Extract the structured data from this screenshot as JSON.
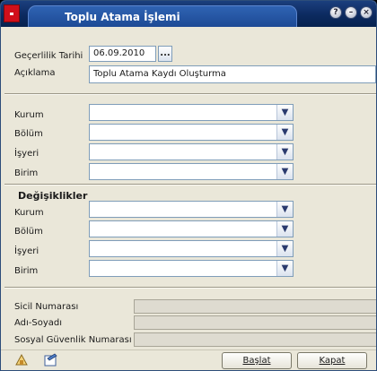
{
  "window": {
    "title": "Toplu Atama İşlemi",
    "controls": {
      "help": "?",
      "minimize": "–",
      "close": "×"
    }
  },
  "top": {
    "date_label": "Geçerlilik Tarihi",
    "date_value": "06.09.2010",
    "date_button": "...",
    "desc_label": "Açıklama",
    "desc_value": "Toplu Atama Kaydı Oluşturma"
  },
  "criteria": {
    "kurum": "Kurum",
    "bolum": "Bölüm",
    "isyeri": "İşyeri",
    "birim": "Birim"
  },
  "changes": {
    "heading": "Değişiklikler",
    "kurum": "Kurum",
    "bolum": "Bölüm",
    "isyeri": "İşyeri",
    "birim": "Birim"
  },
  "info": {
    "sicil": "Sicil Numarası",
    "adsoyad": "Adı-Soyadı",
    "sgk": "Sosyal Güvenlik Numarası"
  },
  "buttons": {
    "start": "Başlat",
    "close": "Kapat"
  },
  "colors": {
    "title_bar": "#0c2a5f",
    "window_bg": "#eae7d9"
  }
}
